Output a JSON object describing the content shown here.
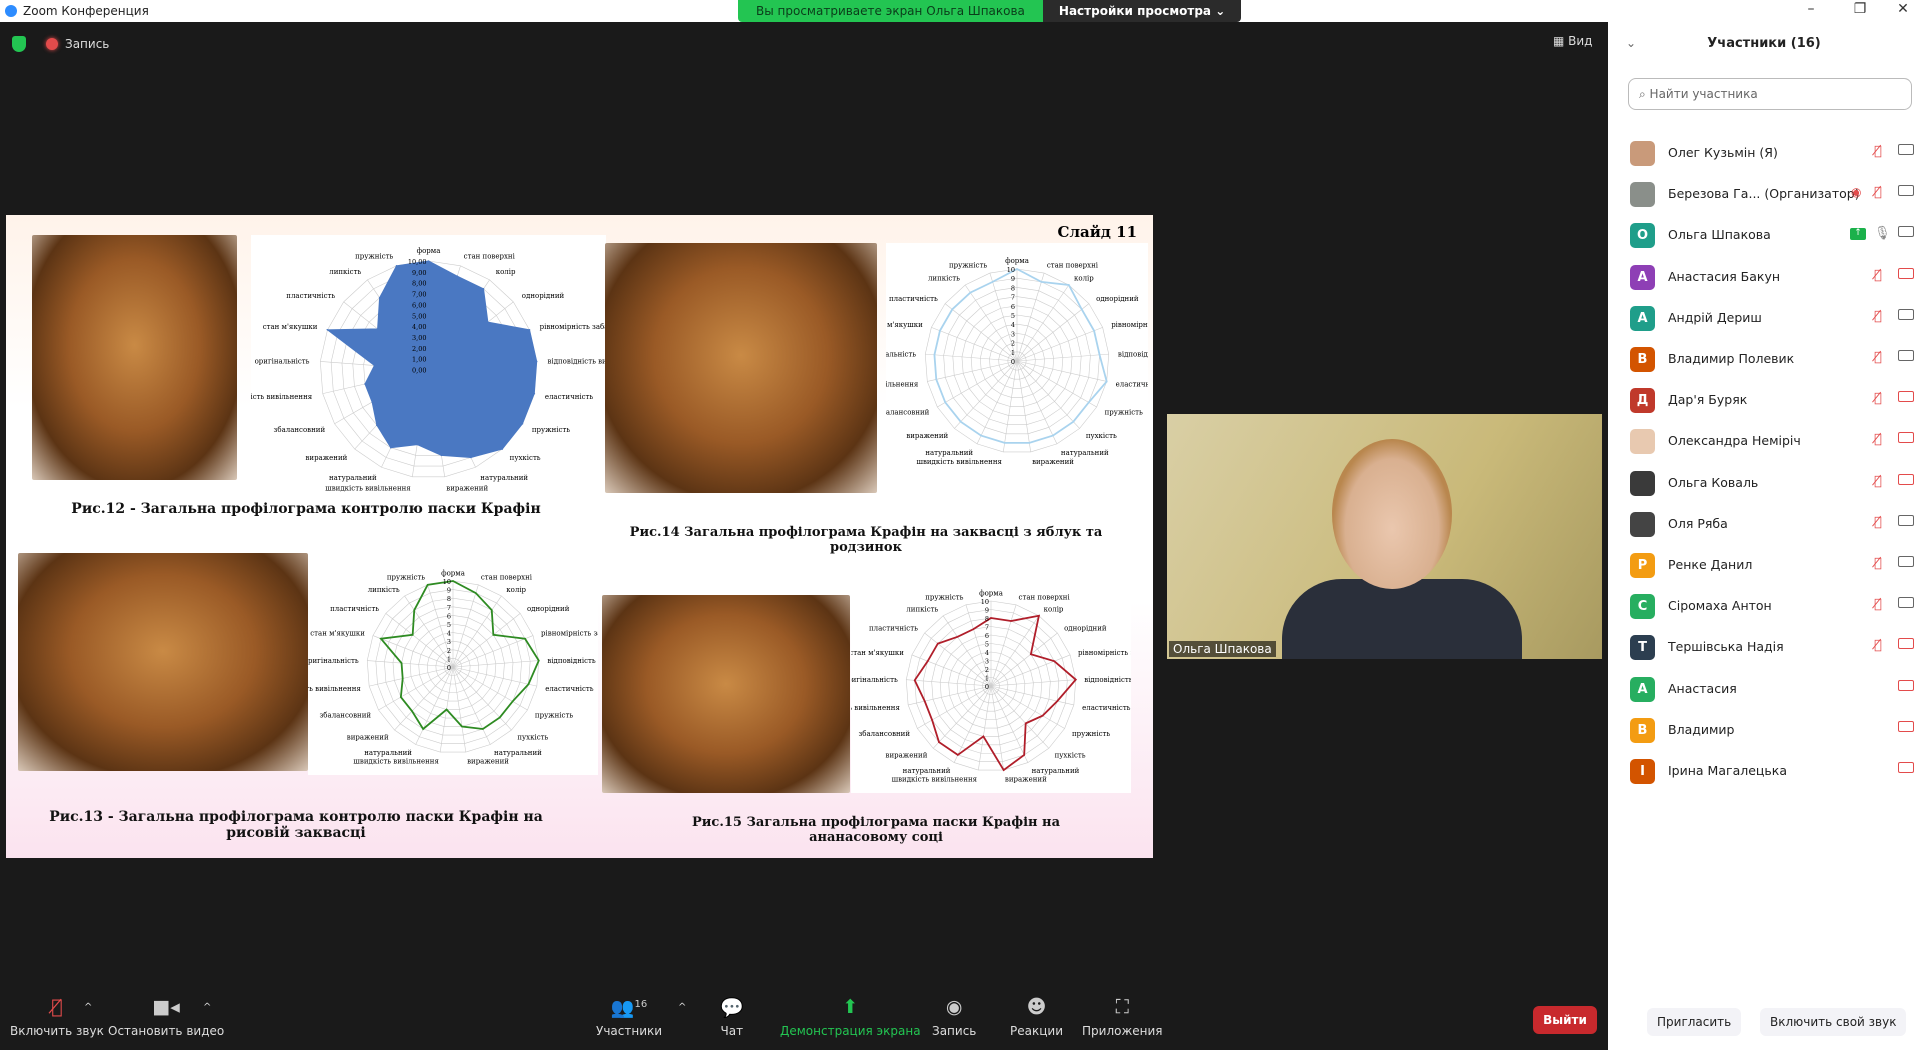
{
  "window": {
    "title": "Zoom Конференция",
    "minimize": "–",
    "restore": "❐",
    "close": "✕"
  },
  "banner": {
    "viewing": "Вы просматриваете экран Ольга Шпакова",
    "view_options": "Настройки просмотра ⌄"
  },
  "stage": {
    "recording": "Запись",
    "view": "▦ Вид"
  },
  "slide": {
    "number": "Слайд 11",
    "captions": [
      "Рис.12 - Загальна профілограма контролю паски Крафін",
      "Рис.14 Загальна профілограма Крафін на заквасці з яблук та родзинок",
      "Рис.13 - Загальна профілограма контролю паски Крафін на рисовій заквасці",
      "Рис.15 Загальна профілограма паски Крафін на ананасовому соці"
    ]
  },
  "chart_data": [
    {
      "type": "radar",
      "name": "Рис.12",
      "color": "#4a78c2",
      "fill": true,
      "rmax": 10,
      "tick_labels": [
        "0,00",
        "1,00",
        "2,00",
        "3,00",
        "4,00",
        "5,00",
        "6,00",
        "7,00",
        "8,00",
        "9,00",
        "10,00"
      ],
      "axes": [
        "форма",
        "стан поверхні",
        "колір",
        "однорідний",
        "рівномірність забарвлення",
        "відповідність вигляд сировини",
        "еластичність",
        "пружність",
        "пухкість",
        "натуральний",
        "виражений",
        "швидкість вивільнення",
        "натуральний",
        "виражений",
        "збалансовний",
        "швидкість вивільнення",
        "оригінальність",
        "стан м'якушки",
        "пластичність",
        "липкість",
        "пружність"
      ],
      "values": [
        10,
        9,
        9,
        7,
        10,
        10,
        10,
        10,
        10,
        9,
        8,
        7,
        8,
        7,
        6,
        6,
        5,
        10,
        6,
        8,
        10
      ]
    },
    {
      "type": "radar",
      "name": "Рис.14",
      "color": "#a9d3ee",
      "fill": false,
      "rmax": 10,
      "tick_labels": [
        "0",
        "1",
        "2",
        "3",
        "4",
        "5",
        "6",
        "7",
        "8",
        "9",
        "10"
      ],
      "axes": [
        "форма",
        "стан поверхні",
        "колір",
        "однорідний",
        "рівномірність забарвлення",
        "відповідність вигляд сировини",
        "еластичність",
        "пружність",
        "пухкість",
        "натуральний",
        "виражений",
        "швидкість вивільнення",
        "натуральний",
        "виражений",
        "збалансовний",
        "швидкість вивільнення",
        "оригінальність",
        "стан м'якушки",
        "пластичність",
        "липкість",
        "пружність"
      ],
      "values": [
        10,
        9,
        10,
        9,
        9,
        9,
        10,
        9,
        9,
        9,
        9,
        9,
        9,
        9,
        9,
        9,
        9,
        9,
        9,
        9,
        9
      ]
    },
    {
      "type": "radar",
      "name": "Рис.13",
      "color": "#2e8b22",
      "fill": false,
      "rmax": 10,
      "tick_labels": [
        "0",
        "1",
        "2",
        "3",
        "4",
        "5",
        "6",
        "7",
        "8",
        "9",
        "10"
      ],
      "axes": [
        "форма",
        "стан поверхні",
        "колір",
        "однорідний",
        "рівномірність забарвлення",
        "відповідність вигляд сировини",
        "еластичність",
        "пружність",
        "пухкість",
        "натуральний",
        "виражений",
        "швидкість вивільнення",
        "натуральний",
        "виражений",
        "збалансовний",
        "швидкість вивільнення",
        "оригінальність",
        "стан м'якушки",
        "пластичність",
        "липкість",
        "пружність"
      ],
      "values": [
        10,
        9,
        8,
        6,
        9,
        10,
        9,
        8,
        8,
        8,
        7,
        5,
        8,
        7,
        7,
        6,
        6,
        9,
        6,
        8,
        10
      ]
    },
    {
      "type": "radar",
      "name": "Рис.15",
      "color": "#b01e2a",
      "fill": false,
      "rmax": 10,
      "tick_labels": [
        "0",
        "1",
        "2",
        "3",
        "4",
        "5",
        "6",
        "7",
        "8",
        "9",
        "10"
      ],
      "axes": [
        "форма",
        "стан поверхні",
        "колір",
        "однорідний",
        "рівномірність забарвлення",
        "відповідність вигляд сировини",
        "еластичність",
        "пружність",
        "пухкість",
        "натуральний",
        "виражений",
        "швидкість вивільнення",
        "натуральний",
        "виражений",
        "збалансовний",
        "швидкість вивільнення",
        "оригінальність",
        "стан м'якушки",
        "пластичність",
        "липкість",
        "пружність"
      ],
      "values": [
        8,
        8,
        10,
        6,
        8,
        10,
        8,
        7,
        6,
        9,
        10,
        6,
        9,
        9,
        8,
        8,
        9,
        8,
        8,
        7,
        7
      ]
    }
  ],
  "video": {
    "name": "Ольга Шпакова"
  },
  "participants": {
    "title": "Участники (16)",
    "search_placeholder": "Найти участника",
    "list": [
      {
        "name": "Олег Кузьмін (Я)",
        "initial": "",
        "color": "#c99a7a",
        "mic": "muted",
        "cam": "on"
      },
      {
        "name": "Березова Га...  (Организатор)",
        "initial": "",
        "color": "#8a8f8a",
        "mic": "muted",
        "cam": "on",
        "recording": true
      },
      {
        "name": "Ольга Шпакова",
        "initial": "О",
        "color": "#1f9e8a",
        "mic": "on",
        "cam": "on",
        "sharing": true
      },
      {
        "name": "Анастасия Бакун",
        "initial": "А",
        "color": "#8e3fb5",
        "mic": "muted",
        "cam": "off"
      },
      {
        "name": "Андрій Дериш",
        "initial": "А",
        "color": "#1f9e8a",
        "mic": "muted",
        "cam": "on"
      },
      {
        "name": "Владимир Полевик",
        "initial": "В",
        "color": "#d35400",
        "mic": "muted",
        "cam": "on"
      },
      {
        "name": "Дар'я Буряк",
        "initial": "Д",
        "color": "#c0392b",
        "mic": "muted",
        "cam": "off"
      },
      {
        "name": "Олександра Неміріч",
        "initial": "",
        "color": "#e8c9b0",
        "mic": "muted",
        "cam": "off"
      },
      {
        "name": "Ольга Коваль",
        "initial": "",
        "color": "#3a3a3a",
        "mic": "muted",
        "cam": "off"
      },
      {
        "name": "Оля Ряба",
        "initial": "",
        "color": "#444",
        "mic": "muted",
        "cam": "on"
      },
      {
        "name": "Ренке Данил",
        "initial": "Р",
        "color": "#f39c12",
        "mic": "muted",
        "cam": "on"
      },
      {
        "name": "Сіромаха Антон",
        "initial": "С",
        "color": "#27ae60",
        "mic": "muted",
        "cam": "on"
      },
      {
        "name": "Тершівська Надія",
        "initial": "Т",
        "color": "#2c3e50",
        "mic": "muted",
        "cam": "off"
      },
      {
        "name": "Анастасия",
        "initial": "А",
        "color": "#27ae60",
        "mic": "none",
        "cam": "off"
      },
      {
        "name": "Владимир",
        "initial": "В",
        "color": "#f39c12",
        "mic": "none",
        "cam": "off"
      },
      {
        "name": "Ірина Магалецька",
        "initial": "І",
        "color": "#d35400",
        "mic": "none",
        "cam": "off"
      }
    ],
    "invite": "Пригласить",
    "unmute_me": "Включить свой звук"
  },
  "toolbar": {
    "unmute": "Включить звук",
    "stop_video": "Остановить видео",
    "participants": "Участники",
    "participants_count": "16",
    "chat": "Чат",
    "share": "Демонстрация экрана",
    "record": "Запись",
    "reactions": "Реакции",
    "apps": "Приложения",
    "leave": "Выйти"
  }
}
